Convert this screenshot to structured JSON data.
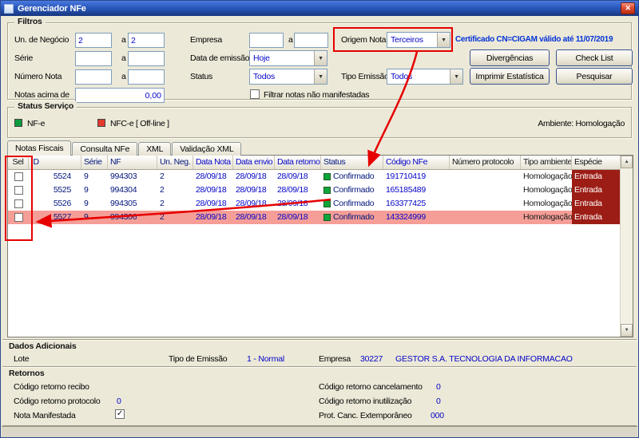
{
  "colors": {
    "annotation": "#e60000",
    "value-blue": "#0404c8",
    "row-highlight": "#f59e97",
    "especie-bg": "#9c1d15",
    "status-green": "#0fa63c",
    "service-green": "#0d9b3d",
    "service-red": "#e23a2e"
  },
  "icons": {
    "close": "✕",
    "dropdown_arrow": "▼",
    "scroll_up": "▲",
    "scroll_down": "▼",
    "check": "✓"
  },
  "window": {
    "title": "Gerenciador NFe"
  },
  "filtros": {
    "title": "Filtros",
    "un_negocio_label": "Un. de Negócio",
    "un_negocio_from": "2",
    "range_sep": "a",
    "un_negocio_to": "2",
    "empresa_label": "Empresa",
    "empresa_from": "",
    "empresa_to": "",
    "origem_label": "Origem Nota",
    "origem_value": "Terceiros",
    "certificado": "Certificado CN=CIGAM válido até 11/07/2019",
    "serie_label": "Série",
    "serie_from": "",
    "serie_to": "",
    "data_emissao_label": "Data de emissão",
    "data_emissao_value": "Hoje",
    "numero_label": "Número Nota",
    "numero_from": "",
    "numero_to": "",
    "status_label": "Status",
    "status_value": "Todos",
    "tipo_emissao_label": "Tipo Emissão",
    "tipo_emissao_value": "Todos",
    "notas_acima_label": "Notas acima de",
    "notas_acima_value": "0,00",
    "filtrar_label": "Filtrar notas não manifestadas",
    "btn_divergencias": "Divergências",
    "btn_checklist": "Check List",
    "btn_imprimir": "Imprimir Estatística",
    "btn_pesquisar": "Pesquisar"
  },
  "status_servico": {
    "title": "Status Serviço",
    "nfe_label": "NF-e",
    "nfce_label": "NFC-e  [ Off-line ]",
    "ambiente": "Ambiente: Homologação"
  },
  "tabs": {
    "notas_fiscais": "Notas Fiscais",
    "consulta_nfe": "Consulta NFe",
    "xml": "XML",
    "validacao_xml": "Validação XML"
  },
  "table": {
    "headers": [
      "Sel",
      "ID",
      "Série",
      "NF",
      "Un. Neg.",
      "Data Nota",
      "Data envio",
      "Data retorno",
      "Status",
      "Código NFe",
      "Número protocolo",
      "Tipo ambiente",
      "Espécie"
    ],
    "rows": [
      {
        "id": "5524",
        "serie": "9",
        "nf": "994303",
        "un_neg": "2",
        "data_nota": "28/09/18",
        "data_envio": "28/09/18",
        "data_retorno": "28/09/18",
        "status": "Confirmado",
        "codigo_nfe": "191710419",
        "protocolo": "",
        "tipo_ambiente": "Homologação",
        "especie": "Entrada"
      },
      {
        "id": "5525",
        "serie": "9",
        "nf": "994304",
        "un_neg": "2",
        "data_nota": "28/09/18",
        "data_envio": "28/09/18",
        "data_retorno": "28/09/18",
        "status": "Confirmado",
        "codigo_nfe": "165185489",
        "protocolo": "",
        "tipo_ambiente": "Homologação",
        "especie": "Entrada"
      },
      {
        "id": "5526",
        "serie": "9",
        "nf": "994305",
        "un_neg": "2",
        "data_nota": "28/09/18",
        "data_envio": "28/09/18",
        "data_retorno": "28/09/18",
        "status": "Confirmado",
        "codigo_nfe": "163377425",
        "protocolo": "",
        "tipo_ambiente": "Homologação",
        "especie": "Entrada"
      },
      {
        "id": "5527",
        "serie": "9",
        "nf": "994306",
        "un_neg": "2",
        "data_nota": "28/09/18",
        "data_envio": "28/09/18",
        "data_retorno": "28/09/18",
        "status": "Confirmado",
        "codigo_nfe": "143324999",
        "protocolo": "",
        "tipo_ambiente": "Homologação",
        "especie": "Entrada"
      }
    ]
  },
  "dados_adicionais": {
    "title": "Dados Adicionais",
    "lote_label": "Lote",
    "tipo_emissao_label": "Tipo de Emissão",
    "tipo_emissao_value": "1 - Normal",
    "empresa_label": "Empresa",
    "empresa_codigo": "30227",
    "empresa_nome": "GESTOR S.A. TECNOLOGIA DA INFORMACAO"
  },
  "retornos": {
    "title": "Retornos",
    "recibo_label": "Código retorno recibo",
    "protocolo_label": "Código retorno protocolo",
    "protocolo_value": "0",
    "manifestada_label": "Nota Manifestada",
    "cancelamento_label": "Código retorno cancelamento",
    "cancelamento_value": "0",
    "inutilizacao_label": "Código retorno inutilização",
    "inutilizacao_value": "0",
    "extemporaneo_label": "Prot. Canc. Extemporâneo",
    "extemporaneo_value": "000"
  }
}
